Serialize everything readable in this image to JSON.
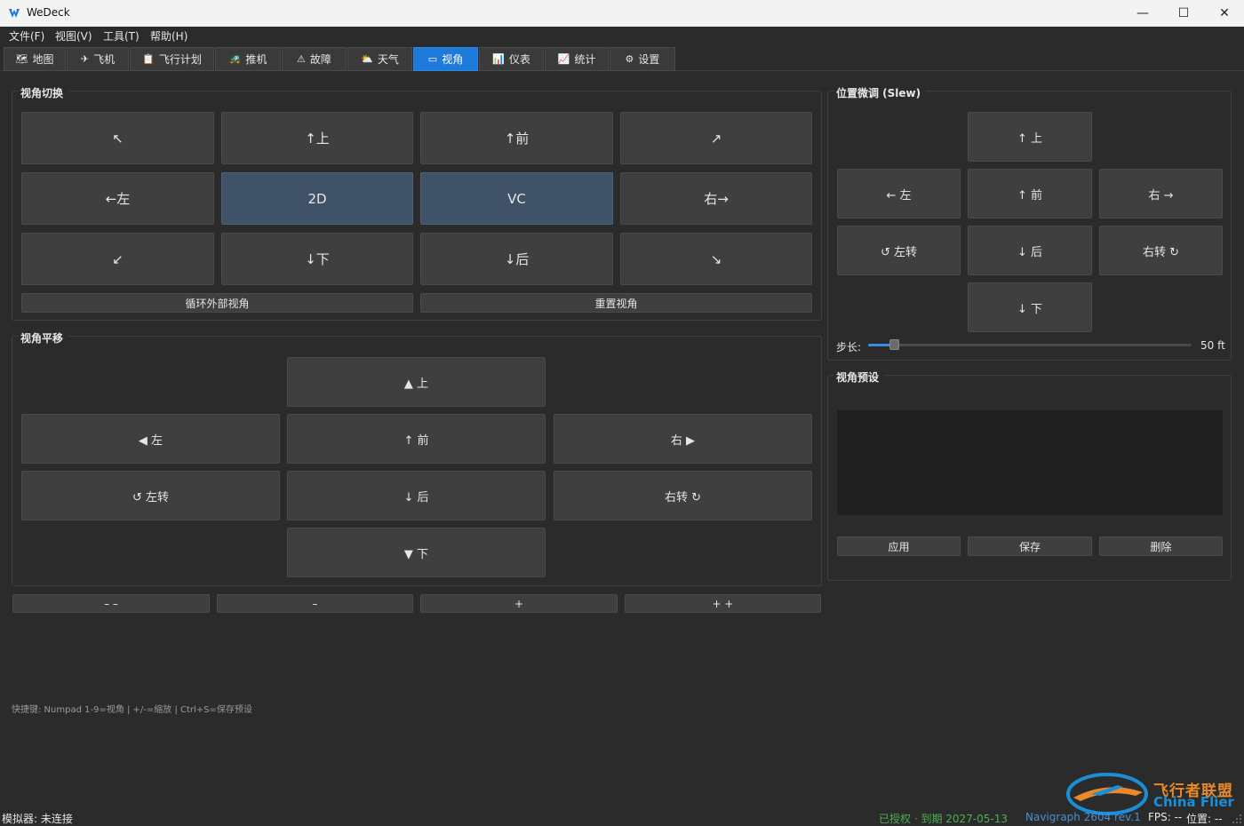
{
  "window": {
    "title": "WeDeck",
    "controls": {
      "minimize": "—",
      "maximize": "☐",
      "close": "✕"
    }
  },
  "menu": [
    "文件(F)",
    "视图(V)",
    "工具(T)",
    "帮助(H)"
  ],
  "tabs": [
    {
      "label": "地图",
      "icon": "🗺"
    },
    {
      "label": "飞机",
      "icon": "✈"
    },
    {
      "label": "飞行计划",
      "icon": "📋"
    },
    {
      "label": "推机",
      "icon": "🚜"
    },
    {
      "label": "故障",
      "icon": "⚠"
    },
    {
      "label": "天气",
      "icon": "⛅"
    },
    {
      "label": "视角",
      "icon": "▭"
    },
    {
      "label": "仪表",
      "icon": "📊"
    },
    {
      "label": "统计",
      "icon": "📈"
    },
    {
      "label": "设置",
      "icon": "⚙"
    }
  ],
  "active_tab": "视角",
  "view_switch": {
    "title": "视角切换",
    "grid": [
      "↖",
      "↑上",
      "↑前",
      "↗",
      "←左",
      "2D",
      "VC",
      "右→",
      "↙",
      "↓下",
      "↓后",
      "↘"
    ],
    "selected": [
      "2D",
      "VC"
    ],
    "cycle_label": "循环外部视角",
    "reset_label": "重置视角"
  },
  "view_pan": {
    "title": "视角平移",
    "up": "▲ 上",
    "left": "◀ 左",
    "forward": "↑ 前",
    "right": "右 ▶",
    "rot_left": "↺ 左转",
    "back": "↓ 后",
    "rot_right": "右转 ↻",
    "down": "▼ 下"
  },
  "zoom": [
    "– –",
    "–",
    "+",
    "+ +"
  ],
  "slew": {
    "title": "位置微调 (Slew)",
    "up": "↑ 上",
    "left": "← 左",
    "forward": "↑ 前",
    "right": "右 →",
    "rot_left": "↺ 左转",
    "back": "↓ 后",
    "rot_right": "右转 ↻",
    "down": "↓ 下",
    "step_label": "步长:",
    "step_value": "50 ft",
    "step_fraction": 0.08
  },
  "presets": {
    "title": "视角预设",
    "apply": "应用",
    "save": "保存",
    "delete": "删除"
  },
  "hint": "快捷键: Numpad 1-9=视角 | +/-=缩放 | Ctrl+S=保存预设",
  "status": {
    "sim": "模拟器: 未连接",
    "license": "已授权 · 到期 2027-05-13",
    "navigraph": "Navigraph 2604 rev.1",
    "fps": "FPS: --",
    "position": "位置: --"
  },
  "watermark": {
    "cn": "飞行者联盟",
    "en": "China Flier"
  },
  "colors": {
    "accent": "#1e7ad8",
    "selected_button": "#3f5267",
    "license_green": "#4caf50",
    "navigraph_blue": "#4a8fd6",
    "watermark_orange": "#e8892a",
    "watermark_blue": "#1a8fd8"
  }
}
